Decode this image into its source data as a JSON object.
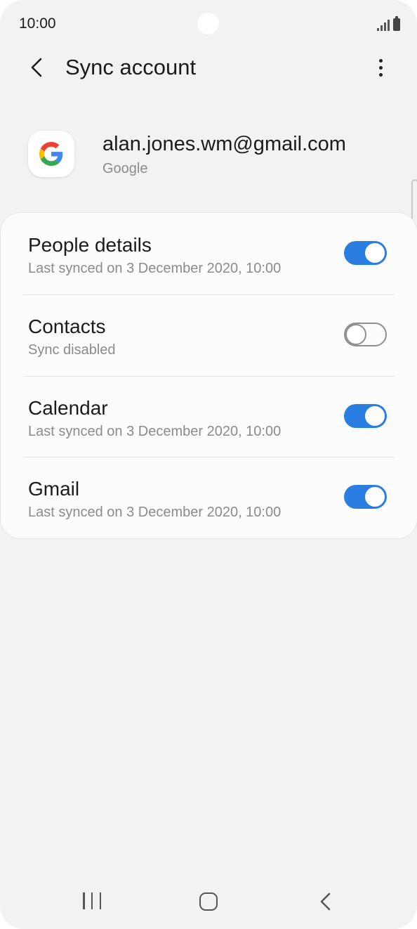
{
  "status_bar": {
    "time": "10:00"
  },
  "app_bar": {
    "title": "Sync account"
  },
  "account": {
    "email": "alan.jones.wm@gmail.com",
    "provider": "Google",
    "icon": "google-icon"
  },
  "sync_items": [
    {
      "label": "People details",
      "status": "Last synced on 3 December 2020, 10:00",
      "enabled": true
    },
    {
      "label": "Contacts",
      "status": "Sync disabled",
      "enabled": false
    },
    {
      "label": "Calendar",
      "status": "Last synced on 3 December 2020, 10:00",
      "enabled": true
    },
    {
      "label": "Gmail",
      "status": "Last synced on 3 December 2020, 10:00",
      "enabled": true
    }
  ],
  "colors": {
    "accent": "#2a7de1",
    "background": "#f2f2f2",
    "card": "#fcfcfc",
    "secondary_text": "#8b8b8b"
  },
  "nav_bar": {
    "icons": [
      "recents-icon",
      "home-icon",
      "back-icon"
    ]
  }
}
